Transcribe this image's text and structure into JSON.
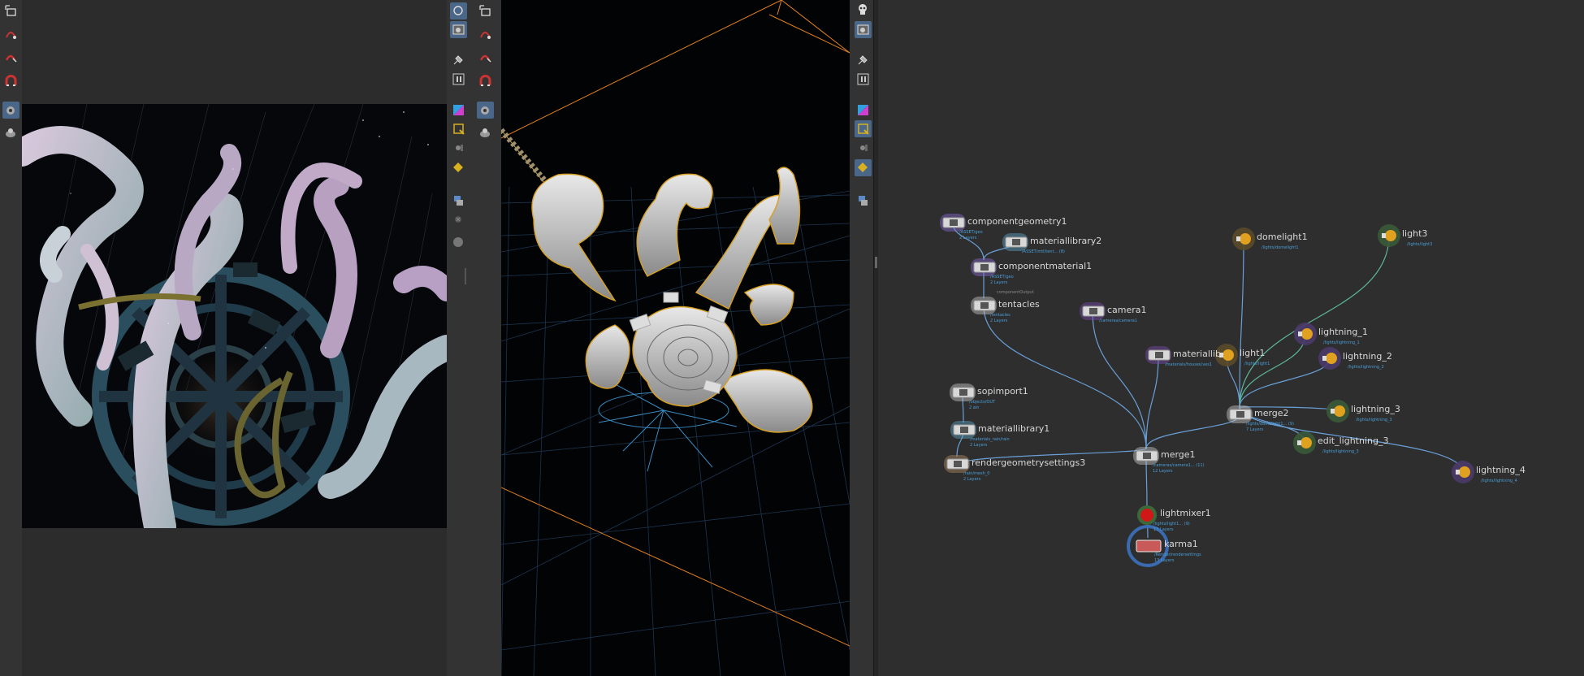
{
  "panes": {
    "render_view": {
      "name": "render-view"
    },
    "scene_viewer": {
      "name": "scene-viewer"
    },
    "network_editor": {
      "name": "network-editor"
    }
  },
  "nodes": [
    {
      "id": "componentgeometry1",
      "label": "componentgeometry1",
      "path": "/ASSET/geo",
      "layers": "2 Layers",
      "color": "#8a6ad0"
    },
    {
      "id": "materiallibrary2",
      "label": "materiallibrary2",
      "path": "/ASSET/mtl/tent... (8)",
      "layers": "",
      "color": "#5da5c8"
    },
    {
      "id": "componentmaterial1",
      "label": "componentmaterial1",
      "path": "/ASSET/geo",
      "layers": "2 Layers",
      "color": "#8a6ad0"
    },
    {
      "id": "tentacles",
      "label": "tentacles",
      "path": "/tentacles",
      "layers": "2 Layers",
      "color": "#c8c8c8"
    },
    {
      "id": "camera1",
      "label": "camera1",
      "path": "/cameras/camera1",
      "layers": "",
      "color": "#7a4ab0"
    },
    {
      "id": "materiallib",
      "label": "materiallib",
      "path": "/materials/houses/ves1",
      "layers": "",
      "color": "#7a4ab0"
    },
    {
      "id": "light1",
      "label": "light1",
      "path": "/lights/light1",
      "layers": "",
      "color": "#e0a020"
    },
    {
      "id": "domelight1",
      "label": "domelight1",
      "path": "/lights/domelight1",
      "layers": "",
      "color": "#e0a020"
    },
    {
      "id": "light3",
      "label": "light3",
      "path": "/lights/light3",
      "layers": "",
      "color": "#e0a020"
    },
    {
      "id": "lightning_1",
      "label": "lightning_1",
      "path": "/lights/lightning_1",
      "layers": "",
      "color": "#e0a020"
    },
    {
      "id": "lightning_2",
      "label": "lightning_2",
      "path": "/lights/lightning_2",
      "layers": "",
      "color": "#e0a020"
    },
    {
      "id": "lightning_3",
      "label": "lightning_3",
      "path": "/lights/lightning_3",
      "layers": "",
      "color": "#e0a020"
    },
    {
      "id": "edit_lightning_3",
      "label": "edit_lightning_3",
      "path": "/lights/lightning_3",
      "layers": "",
      "color": "#e0a020"
    },
    {
      "id": "lightning_4",
      "label": "lightning_4",
      "path": "/lights/lightning_4",
      "layers": "",
      "color": "#e0a020"
    },
    {
      "id": "merge2",
      "label": "merge2",
      "path": "/lights/domelight1... (9)",
      "layers": "7 Layers",
      "color": "#c8c8c8"
    },
    {
      "id": "sopimport1",
      "label": "sopimport1",
      "path": "/objects/OUT",
      "layers": "2 ain",
      "color": "#c8c8c8"
    },
    {
      "id": "materiallibrary1",
      "label": "materiallibrary1",
      "path": "/materials_rain/rain",
      "layers": "2 Layers",
      "color": "#5da5c8"
    },
    {
      "id": "rendergeometrysettings3",
      "label": "rendergeometrysettings3",
      "path": "/rain/mesh_0",
      "layers": "2 Layers",
      "color": "#b08a60"
    },
    {
      "id": "merge1",
      "label": "merge1",
      "path": "/cameras/camera1... (11)",
      "layers": "12 Layers",
      "color": "#c8c8c8"
    },
    {
      "id": "lightmixer1",
      "label": "lightmixer1",
      "path": "/lights/light1... (9)",
      "layers": "13 Layers",
      "color": "#d01818"
    },
    {
      "id": "karma1",
      "label": "karma1",
      "path": "/Render/rendersettings",
      "layers": "13 Layers",
      "color": "#c85a5a"
    }
  ],
  "tentacles_subtitle": "componentOutput",
  "colors": {
    "wire": "#6aa0d8",
    "wire_light": "#5cb89a",
    "orange_guide": "#e08020",
    "grid": "#1d3a55",
    "background": "#2e2e2e"
  }
}
